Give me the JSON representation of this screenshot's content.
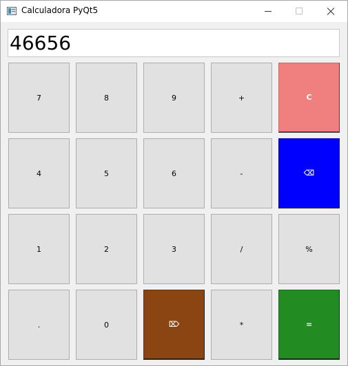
{
  "window": {
    "title": "Calculadora PyQt5"
  },
  "display": {
    "value": "46656"
  },
  "keys": {
    "row1": [
      "7",
      "8",
      "9",
      "+",
      "C"
    ],
    "row2": [
      "4",
      "5",
      "6",
      "-",
      "⌫"
    ],
    "row3": [
      "1",
      "2",
      "3",
      "/",
      "%"
    ],
    "row4": [
      ".",
      "0",
      "⌦",
      "*",
      "="
    ]
  },
  "colors": {
    "clear": "#f08080",
    "backspace": "#0000ff",
    "delete": "#8b4513",
    "equals": "#228b22",
    "key_default": "#e1e1e1"
  },
  "icons": {
    "app": "calculator-app-icon",
    "minimize": "minimize-icon",
    "maximize": "maximize-icon",
    "close": "close-icon"
  }
}
